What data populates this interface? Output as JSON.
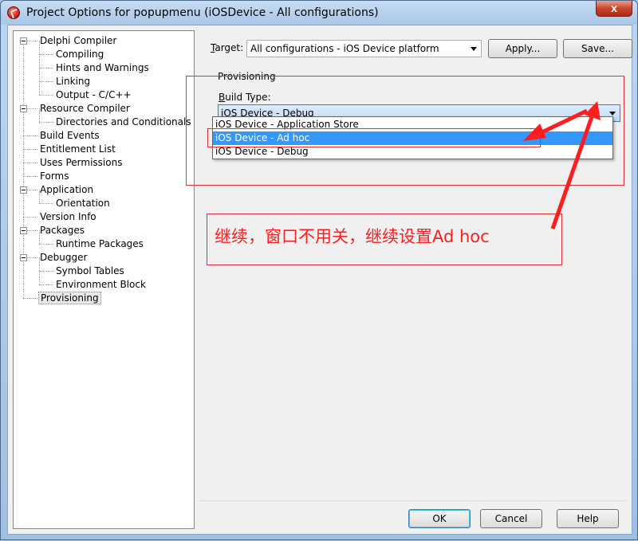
{
  "window": {
    "title": "Project Options for popupmenu  (iOSDevice - All configurations)",
    "close_glyph": "x",
    "close_icon": "close-icon"
  },
  "tree": {
    "items": [
      {
        "label": "Delphi Compiler",
        "level": 0,
        "expandable": true
      },
      {
        "label": "Compiling",
        "level": 1
      },
      {
        "label": "Hints and Warnings",
        "level": 1
      },
      {
        "label": "Linking",
        "level": 1
      },
      {
        "label": "Output - C/C++",
        "level": 1
      },
      {
        "label": "Resource Compiler",
        "level": 0,
        "expandable": true
      },
      {
        "label": "Directories and Conditionals",
        "level": 1
      },
      {
        "label": "Build Events",
        "level": 0
      },
      {
        "label": "Entitlement List",
        "level": 0
      },
      {
        "label": "Uses Permissions",
        "level": 0
      },
      {
        "label": "Forms",
        "level": 0
      },
      {
        "label": "Application",
        "level": 0,
        "expandable": true
      },
      {
        "label": "Orientation",
        "level": 1
      },
      {
        "label": "Version Info",
        "level": 0
      },
      {
        "label": "Packages",
        "level": 0,
        "expandable": true
      },
      {
        "label": "Runtime Packages",
        "level": 1
      },
      {
        "label": "Debugger",
        "level": 0,
        "expandable": true
      },
      {
        "label": "Symbol Tables",
        "level": 1
      },
      {
        "label": "Environment Block",
        "level": 1
      },
      {
        "label": "Provisioning",
        "level": 0,
        "selected": true
      }
    ]
  },
  "target": {
    "label_prefix": "",
    "label_underlined": "T",
    "label_rest": "arget:",
    "value": "All configurations - iOS Device platform"
  },
  "buttons": {
    "apply": "Apply...",
    "save": "Save...",
    "ok": "OK",
    "cancel": "Cancel",
    "help": "Help"
  },
  "provisioning": {
    "group_title": "Provisioning",
    "build_type_label_underlined": "B",
    "build_type_label_rest": "uild Type:",
    "build_type_value": "iOS Device - Debug",
    "options": [
      "iOS Device - Application Store",
      "iOS Device - Ad hoc",
      "iOS Device - Debug"
    ],
    "highlighted_index": 1
  },
  "annotation": {
    "text": "继续，窗口不用关，继续设置Ad hoc",
    "color": "#ff1e1e"
  }
}
